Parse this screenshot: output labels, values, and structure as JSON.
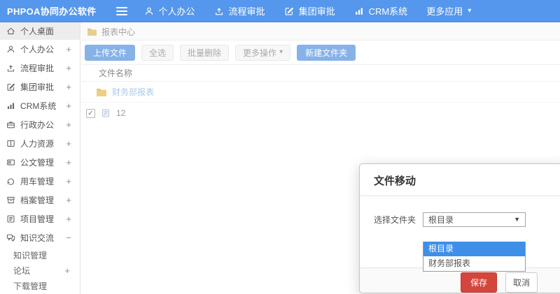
{
  "navbar": {
    "brand": "PHPOA协同办公软件",
    "items": [
      {
        "icon": "user-icon",
        "label": "个人办公"
      },
      {
        "icon": "workflow-approval-icon",
        "label": "流程审批"
      },
      {
        "icon": "edit-square-icon",
        "label": "集团审批"
      },
      {
        "icon": "bar-chart-icon",
        "label": "CRM系统"
      },
      {
        "icon": "chevron-down-icon",
        "label": "更多应用"
      }
    ]
  },
  "sidebar": {
    "items": [
      {
        "label": "个人桌面",
        "suffix": "",
        "active": true
      },
      {
        "label": "个人办公",
        "suffix": "+"
      },
      {
        "label": "流程审批",
        "suffix": "+"
      },
      {
        "label": "集团审批",
        "suffix": "+"
      },
      {
        "label": "CRM系统",
        "suffix": "+"
      },
      {
        "label": "行政办公",
        "suffix": "+"
      },
      {
        "label": "人力资源",
        "suffix": "+"
      },
      {
        "label": "公文管理",
        "suffix": "+"
      },
      {
        "label": "用车管理",
        "suffix": "+"
      },
      {
        "label": "档案管理",
        "suffix": "+"
      },
      {
        "label": "项目管理",
        "suffix": "+"
      },
      {
        "label": "知识交流",
        "suffix": "−",
        "expanded": true
      }
    ],
    "subitems": [
      {
        "label": "知识管理",
        "suffix": ""
      },
      {
        "label": "论坛",
        "suffix": "+"
      },
      {
        "label": "下载管理",
        "suffix": ""
      }
    ]
  },
  "breadcrumb": {
    "label": "报表中心"
  },
  "toolbar": {
    "upload": "上传文件",
    "select_all": "全选",
    "batch_delete": "批量删除",
    "more_ops": "更多操作",
    "new_folder": "新建文件夹"
  },
  "file_table": {
    "name_header": "文件名称",
    "folder_row": {
      "name": "财务部报表"
    },
    "file_row": {
      "name": "12",
      "checked": true
    }
  },
  "modal": {
    "title": "文件移动",
    "field_label": "选择文件夹",
    "select_value": "根目录",
    "options": [
      {
        "label": "根目录",
        "selected": true
      },
      {
        "label": "财务部报表",
        "selected": false
      }
    ],
    "save_label": "保存",
    "cancel_label": "取消"
  },
  "icons": {
    "caret_down": "▾",
    "select_caret": "▼",
    "check": "✓"
  },
  "colors": {
    "navbar_blue": "#5597ec",
    "primary_button_blue": "#87b2e7",
    "selected_option_blue": "#3e8fe8",
    "save_red": "#d4453c",
    "folder_yellow": "#eecb80",
    "link_blue": "#aac8ec"
  }
}
